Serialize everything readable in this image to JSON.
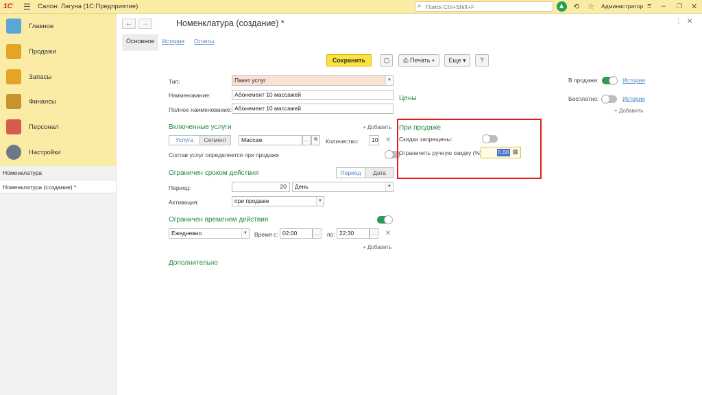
{
  "topbar": {
    "logo": "1С",
    "app_title": "Салон: Лагуна  (1С:Предприятие)",
    "search_placeholder": "Поиск Ctrl+Shift+F",
    "user": "Администратор"
  },
  "sidebar": {
    "sections": [
      {
        "label": "Главное",
        "icon": "clipboard-icon",
        "color": "#5aa7d6"
      },
      {
        "label": "Продажи",
        "icon": "chart-icon",
        "color": "#e3a526"
      },
      {
        "label": "Запасы",
        "icon": "box-icon",
        "color": "#e3a526"
      },
      {
        "label": "Финансы",
        "icon": "wallet-icon",
        "color": "#c8922d"
      },
      {
        "label": "Персонал",
        "icon": "people-icon",
        "color": "#d65c4b"
      },
      {
        "label": "Настройки",
        "icon": "gear-icon",
        "color": "#6d7a86"
      }
    ],
    "open_windows": [
      {
        "label": "Номенклатура",
        "active": false
      },
      {
        "label": "Номенклатура (создание) *",
        "active": true
      }
    ]
  },
  "form": {
    "title": "Номенклатура (создание) *",
    "tabs": [
      "Основное",
      "История",
      "Отчеты"
    ],
    "toolbar": {
      "save": "Сохранить",
      "print": "Печать",
      "more": "Еще",
      "help": "?"
    },
    "fields": {
      "type_label": "Тип:",
      "type_value": "Пакет услуг",
      "name_label": "Наименование:",
      "name_value": "Абонемент 10 массажей",
      "fullname_label": "Полное наименование:",
      "fullname_value": "Абонемент 10 массажей"
    },
    "included": {
      "title": "Включенные услуги",
      "add": "+ Добавить",
      "seg_service": "Услуга",
      "seg_segment": "Сегмент",
      "service_value": "Массаж",
      "qty_label": "Количество:",
      "qty_value": "10",
      "composition_label": "Состав услуг определяется при продаже"
    },
    "limited_period": {
      "title": "Ограничен сроком действия",
      "period_btn": "Период",
      "date_btn": "Дата",
      "period_label": "Период:",
      "period_value": "20",
      "period_unit": "День",
      "activation_label": "Активация:",
      "activation_value": "при продаже"
    },
    "limited_time": {
      "title": "Ограничен временем действия",
      "schedule": "Ежедневно",
      "time_from_label": "Время с:",
      "time_from": "02:00",
      "time_to_label": "по:",
      "time_to": "22:30",
      "add": "+ Добавить"
    },
    "additional": "Дополнительно",
    "prices": {
      "title": "Цены",
      "on_sale_label": "В продаже:",
      "free_label": "Бесплатно:",
      "history_link": "История",
      "add": "+ Добавить"
    },
    "at_sale": {
      "title": "При продаже",
      "discounts_forbidden_label": "Скидки запрещены:",
      "limit_discount_label": "Ограничить ручную скидку (%):",
      "limit_discount_value": "0,00"
    }
  },
  "colors": {
    "accent_yellow": "#fbeca5",
    "save_button": "#fce23b",
    "section_green": "#27893f",
    "highlight_red": "#e21b1b",
    "link_blue": "#4b7fc4"
  }
}
